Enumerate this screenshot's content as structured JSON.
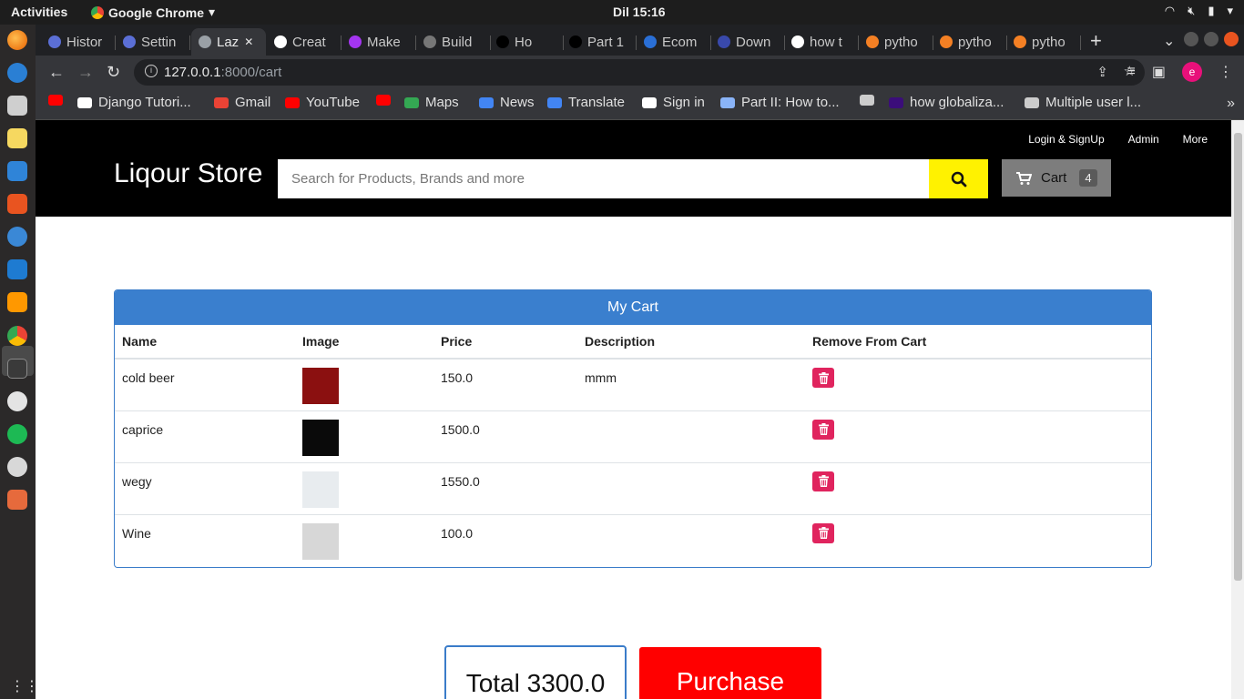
{
  "system": {
    "activities": "Activities",
    "app_name": "Google Chrome",
    "clock": "Dil 15:16"
  },
  "browser": {
    "tabs": [
      {
        "label": "Histor",
        "icon": "history-icon",
        "color": "#5b6fd6"
      },
      {
        "label": "Settin",
        "icon": "settings-icon",
        "color": "#5b6fd6"
      },
      {
        "label": "Laz",
        "icon": "globe-icon",
        "color": "#9aa0a6",
        "active": true
      },
      {
        "label": "Creat",
        "icon": "medium-icon",
        "color": "#ffffff"
      },
      {
        "label": "Make",
        "icon": "udemy-icon",
        "color": "#a435f0"
      },
      {
        "label": "Build",
        "icon": "globe-icon",
        "color": "#777777"
      },
      {
        "label": "Ho",
        "icon": "dev-icon",
        "color": "#000000"
      },
      {
        "label": "Part 1",
        "icon": "patreon-icon",
        "color": "#000000"
      },
      {
        "label": "Ecom",
        "icon": "headphones-icon",
        "color": "#2a6fd6"
      },
      {
        "label": "Down",
        "icon": "person-icon",
        "color": "#3949ab"
      },
      {
        "label": "how t",
        "icon": "google-icon",
        "color": "#ffffff"
      },
      {
        "label": "pytho",
        "icon": "stackoverflow-icon",
        "color": "#f48024"
      },
      {
        "label": "pytho",
        "icon": "stackoverflow-icon",
        "color": "#f48024"
      },
      {
        "label": "pytho",
        "icon": "stackoverflow-icon",
        "color": "#f48024"
      }
    ],
    "url_host": "127.0.0.1",
    "url_path": ":8000/cart",
    "profile_initial": "e",
    "bookmarks": [
      {
        "label": "",
        "icon": "youtube-icon",
        "color": "#ff0000"
      },
      {
        "label": "Django Tutori...",
        "icon": "django-icon",
        "color": "#ffffff"
      },
      {
        "label": "Gmail",
        "icon": "gmail-icon",
        "color": "#ea4335"
      },
      {
        "label": "YouTube",
        "icon": "youtube-icon",
        "color": "#ff0000"
      },
      {
        "label": "",
        "icon": "youtube-icon",
        "color": "#ff0000"
      },
      {
        "label": "Maps",
        "icon": "maps-icon",
        "color": "#34a853"
      },
      {
        "label": "News",
        "icon": "news-icon",
        "color": "#4285f4"
      },
      {
        "label": "Translate",
        "icon": "translate-icon",
        "color": "#4285f4"
      },
      {
        "label": "Sign in",
        "icon": "github-icon",
        "color": "#ffffff"
      },
      {
        "label": "Part II: How to...",
        "icon": "code-icon",
        "color": "#8ab4f8"
      },
      {
        "label": "",
        "icon": "globe-icon",
        "color": "#cccccc"
      },
      {
        "label": "how globaliza...",
        "icon": "b-icon",
        "color": "#3b0d7a"
      },
      {
        "label": "Multiple user l...",
        "icon": "globe-icon",
        "color": "#cccccc"
      }
    ]
  },
  "site": {
    "brand": "Liqour Store",
    "links": [
      "Login & SignUp",
      "Admin",
      "More"
    ],
    "search_placeholder": "Search for Products, Brands and more",
    "cart_label": "Cart",
    "cart_count": "4"
  },
  "cart": {
    "title": "My Cart",
    "columns": [
      "Name",
      "Image",
      "Price",
      "Description",
      "Remove From Cart"
    ],
    "rows": [
      {
        "name": "cold beer",
        "price": "150.0",
        "description": "mmm",
        "thumb": "#8b1010"
      },
      {
        "name": "caprice",
        "price": "1500.0",
        "description": "",
        "thumb": "#0a0a0a"
      },
      {
        "name": "wegy",
        "price": "1550.0",
        "description": "",
        "thumb": "#e8ecef"
      },
      {
        "name": "Wine",
        "price": "100.0",
        "description": "",
        "thumb": "#d7d7d7"
      }
    ],
    "total_label": "Total 3300.0",
    "purchase_label": "Purchase"
  },
  "colors": {
    "header_bg": "#000000",
    "search_button": "#fff200",
    "panel_header": "#3a7fce",
    "delete_button": "#e0245e",
    "purchase": "#ff0000"
  }
}
